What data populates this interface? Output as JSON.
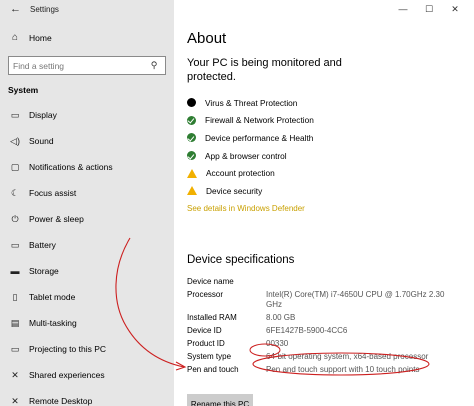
{
  "window": {
    "title": "Settings",
    "back_glyph": "←",
    "controls": {
      "minimize": "—",
      "maximize": "☐",
      "close": "✕"
    }
  },
  "sidebar": {
    "home": {
      "icon": "home-icon",
      "glyph": "⌂",
      "label": "Home"
    },
    "search": {
      "placeholder": "Find a setting",
      "icon": "search-icon",
      "glyph": "⚲"
    },
    "section_heading": "System",
    "items": [
      {
        "icon": "display-icon",
        "glyph": "▭",
        "label": "Display"
      },
      {
        "icon": "sound-icon",
        "glyph": "◁)",
        "label": "Sound"
      },
      {
        "icon": "notifications-icon",
        "glyph": "▢",
        "label": "Notifications & actions"
      },
      {
        "icon": "focus-assist-icon",
        "glyph": "☾",
        "label": "Focus assist"
      },
      {
        "icon": "power-icon",
        "glyph": "⏻",
        "label": "Power & sleep"
      },
      {
        "icon": "battery-icon",
        "glyph": "▭",
        "label": "Battery"
      },
      {
        "icon": "storage-icon",
        "glyph": "▬",
        "label": "Storage"
      },
      {
        "icon": "tablet-mode-icon",
        "glyph": "▯",
        "label": "Tablet mode"
      },
      {
        "icon": "multitasking-icon",
        "glyph": "▤",
        "label": "Multi-tasking"
      },
      {
        "icon": "projecting-icon",
        "glyph": "▭",
        "label": "Projecting to this PC"
      },
      {
        "icon": "shared-experiences-icon",
        "glyph": "✕",
        "label": "Shared experiences"
      },
      {
        "icon": "remote-desktop-icon",
        "glyph": "✕",
        "label": "Remote Desktop"
      }
    ]
  },
  "content": {
    "title": "About",
    "monitor_text": "Your PC is being monitored and protected.",
    "status_items": [
      {
        "status": "black",
        "label": "Virus & Threat Protection"
      },
      {
        "status": "ok",
        "label": "Firewall & Network Protection"
      },
      {
        "status": "ok",
        "label": "Device performance & Health"
      },
      {
        "status": "ok",
        "label": "App & browser control"
      },
      {
        "status": "warn",
        "label": "Account protection"
      },
      {
        "status": "warn",
        "label": "Device security"
      }
    ],
    "defender_link": "See details in Windows Defender",
    "spec_heading": "Device specifications",
    "specs": [
      {
        "key": "Device name",
        "value": ""
      },
      {
        "key": "Processor",
        "value": "Intel(R) Core(TM) i7-4650U CPU @ 1.70GHz   2.30 GHz"
      },
      {
        "key": "Installed RAM",
        "value": "8.00 GB"
      },
      {
        "key": "Device ID",
        "value": "6FE1427B-5900-4CC6"
      },
      {
        "key": "Product ID",
        "value": "00330"
      },
      {
        "key": "System type",
        "value": "64-bit operating system, x64-based processor"
      },
      {
        "key": "Pen and touch",
        "value": "Pen and touch support with 10 touch points"
      }
    ],
    "rename_button": "Rename this PC"
  },
  "colors": {
    "sidebar_bg": "#e6e6e6",
    "ok_green": "#2e7d32",
    "warn_yellow": "#f1b000",
    "link_color": "#c9a000",
    "annotation_red": "#cc1f1f"
  }
}
